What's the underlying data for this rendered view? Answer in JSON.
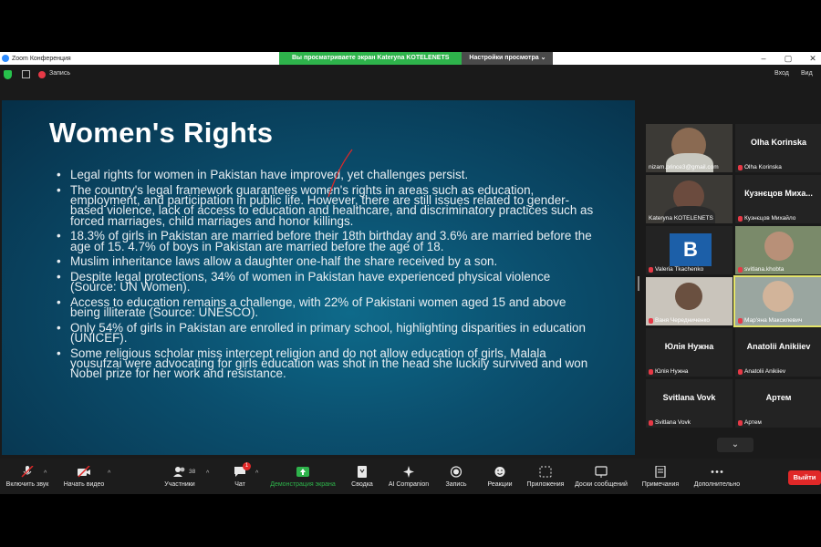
{
  "app": {
    "title": "Zoom Конференция",
    "share_banner": "Вы просматриваете экран Kateryna KOTELENETS",
    "view_settings": "Настройки просмотра",
    "recording_label": "Запись",
    "exit_label": "Вход",
    "view_label": "Вид"
  },
  "slide": {
    "title": "Women's Rights",
    "bullets": [
      "Legal rights for women in Pakistan have improved, yet challenges persist.",
      "The country's legal framework guarantees women's rights in areas such as education, employment, and participation in public life. However, there are still issues related to gender-based violence, lack of access to education and healthcare, and discriminatory practices such as forced marriages, child marriages and honor killings.",
      "18.3% of girls in Pakistan are married before their 18th birthday and 3.6% are married before the age of 15. 4.7% of boys in Pakistan are married before the age of 18.",
      "Muslim inheritance laws allow a daughter one-half the share received by a son.",
      "Despite legal protections, 34% of women in Pakistan have experienced physical violence (Source: UN Women).",
      "Access to education remains a challenge, with 22% of Pakistani women aged 15 and above being illiterate (Source: UNESCO).",
      "Only 54% of girls in Pakistan are enrolled in primary school, highlighting disparities in education (UNICEF).",
      "Some religious scholar miss intercept religion and do not allow education of girls, Malala yousufzai were advocating for girls education was shot in the head she luckily survived and won Nobel prize  for her work and resistance."
    ]
  },
  "participants": [
    {
      "big": "",
      "label": "nizam.prince3@gmail.com",
      "muted": false
    },
    {
      "big": "Olha Korinska",
      "label": "Olha Korinska",
      "muted": true
    },
    {
      "big": "",
      "label": "Kateryna KOTELENETS",
      "muted": false
    },
    {
      "big": "Кузнєцов Миха...",
      "label": "Кузнєцов Михайло",
      "muted": true
    },
    {
      "big": "B",
      "label": "Valeria Tkachenko",
      "muted": true
    },
    {
      "big": "",
      "label": "svitlana.khobta",
      "muted": true
    },
    {
      "big": "",
      "label": "Ваня Чередниченко",
      "muted": true
    },
    {
      "big": "",
      "label": "Мар'яна Максилевич",
      "muted": true
    },
    {
      "big": "Юлія Нужна",
      "label": "Юлія Нужна",
      "muted": true
    },
    {
      "big": "Anatolii Anikiiev",
      "label": "Anatolii Anikiiev",
      "muted": true
    },
    {
      "big": "Svitlana Vovk",
      "label": "Svitlana Vovk",
      "muted": true
    },
    {
      "big": "Артем",
      "label": "Артем",
      "muted": true
    }
  ],
  "toolbar": {
    "mic": "Включить звук",
    "video": "Начать видео",
    "participants": "Участники",
    "participants_count": "38",
    "chat": "Чат",
    "chat_badge": "1",
    "share": "Демонстрация экрана",
    "summary": "Сводка",
    "ai": "AI Companion",
    "record": "Запись",
    "reactions": "Реакции",
    "apps": "Приложения",
    "whiteboards": "Доски сообщений",
    "notes": "Примечания",
    "more": "Дополнительно",
    "leave": "Выйти"
  },
  "colors": {
    "share_green": "#2eb34b",
    "leave_red": "#e02828",
    "slide_bg": "#0b4f6e"
  }
}
